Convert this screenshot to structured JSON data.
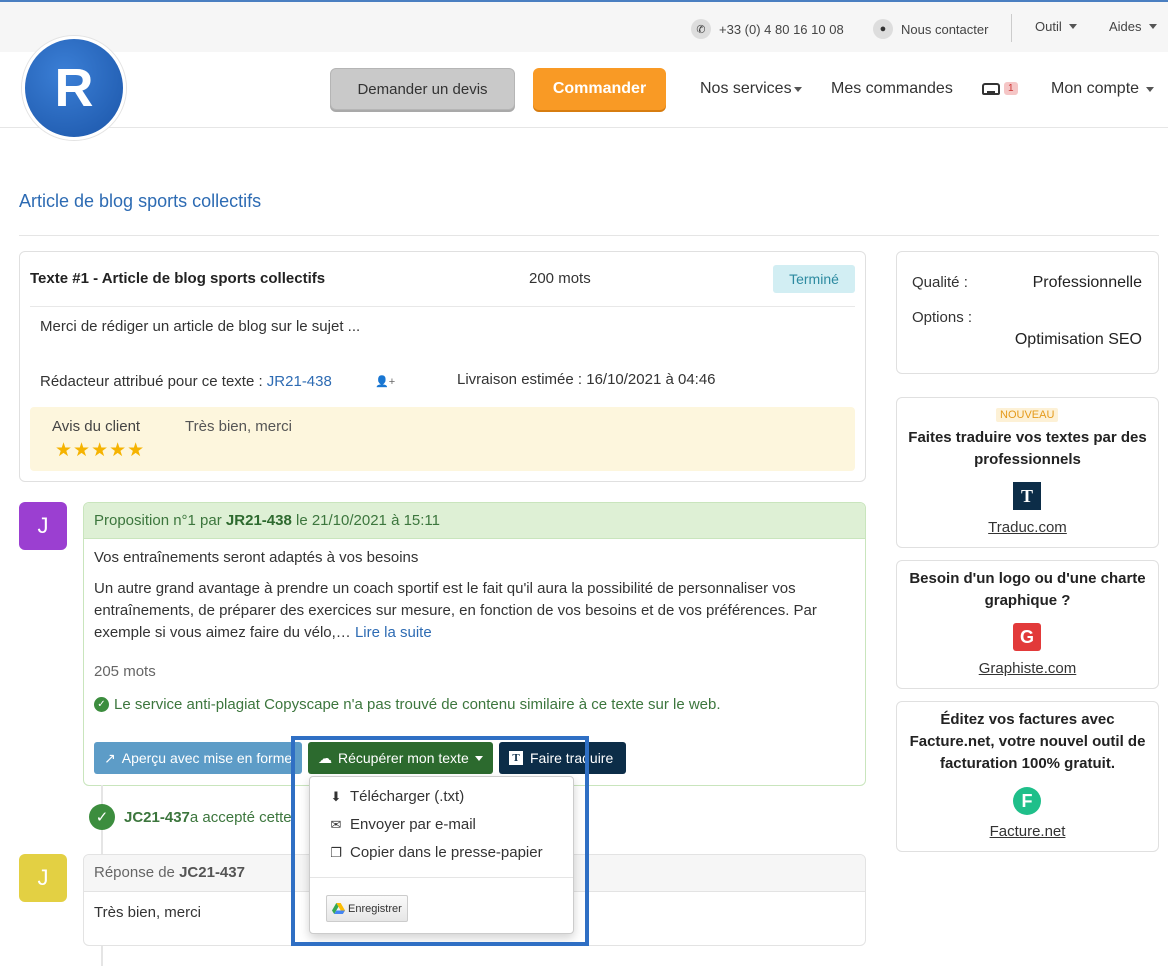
{
  "topbar": {
    "phone": "+33 (0) 4 80 16 10 08",
    "contact": "Nous contacter",
    "tool": "Outil",
    "help": "Aides"
  },
  "header": {
    "logo_letter": "R",
    "quote_button": "Demander un devis",
    "order_button": "Commander",
    "nav_services": "Nos services",
    "nav_orders": "Mes commandes",
    "inbox_count": "1",
    "nav_account": "Mon compte"
  },
  "page_title": "Article de blog sports collectifs",
  "text_card": {
    "title": "Texte #1 - Article de blog sports collectifs",
    "words": "200 mots",
    "status": "Terminé",
    "description": "Merci de rédiger un article de blog sur le sujet ...",
    "writer_label": "Rédacteur attribué pour ce texte : ",
    "writer_id": "JR21-438",
    "delivery": "Livraison estimée : 16/10/2021 à 04:46",
    "review_label": "Avis du client",
    "stars": "★★★★★",
    "rating": 5,
    "review_text": "Très bien, merci"
  },
  "proposal": {
    "avatar": "J",
    "avatar_color": "#9b3fd1",
    "head_prefix": "Proposition n°1 par ",
    "head_author": "JR21-438",
    "head_date": " le 21/10/2021 à 15:11",
    "title": "Vos entraînements seront adaptés à vos besoins",
    "excerpt": "Un autre grand avantage à prendre un coach sportif est le fait qu'il aura la possibilité de personnaliser vos entraînements, de préparer des exercices sur mesure, en fonction de vos besoins et de vos préférences. Par exemple si vous aimez faire du vélo,… ",
    "read_more": "Lire la suite",
    "words": "205 mots",
    "copyscape": "Le service anti-plagiat Copyscape n'a pas trouvé de contenu similaire à ce texte sur le web.",
    "btn_preview": "Aperçu avec mise en forme",
    "btn_get": "Récupérer mon texte",
    "btn_translate": "Faire traduire"
  },
  "accepted": {
    "author": "JC21-437",
    "text": " a accepté cette"
  },
  "response": {
    "avatar": "J",
    "avatar_color": "#e3d043",
    "head_prefix": "Réponse de ",
    "head_author": "JC21-437",
    "body": "Très bien, merci"
  },
  "dropdown": {
    "download": "Télécharger (.txt)",
    "email": "Envoyer par e-mail",
    "copy": "Copier dans le presse-papier",
    "gdrive": "Enregistrer"
  },
  "sidebar": {
    "quality_label": "Qualité :",
    "quality_value": "Professionnelle",
    "options_label": "Options :",
    "options_value": "Optimisation SEO",
    "promo1_badge": "NOUVEAU",
    "promo1_title": "Faites traduire vos textes par des professionnels",
    "promo1_link": "Traduc.com",
    "promo1_logo": "T",
    "promo2_title": "Besoin d'un logo ou d'une charte graphique ?",
    "promo2_link": "Graphiste.com",
    "promo2_logo": "G",
    "promo3_title": "Éditez vos factures avec Facture.net, votre nouvel outil de facturation 100% gratuit.",
    "promo3_link": "Facture.net",
    "promo3_logo": "F"
  },
  "colors": {
    "accent_blue": "#2d6bb3",
    "order_orange": "#f99a25",
    "success_green": "#3c763d",
    "highlight_blue": "#2f6fc4"
  }
}
